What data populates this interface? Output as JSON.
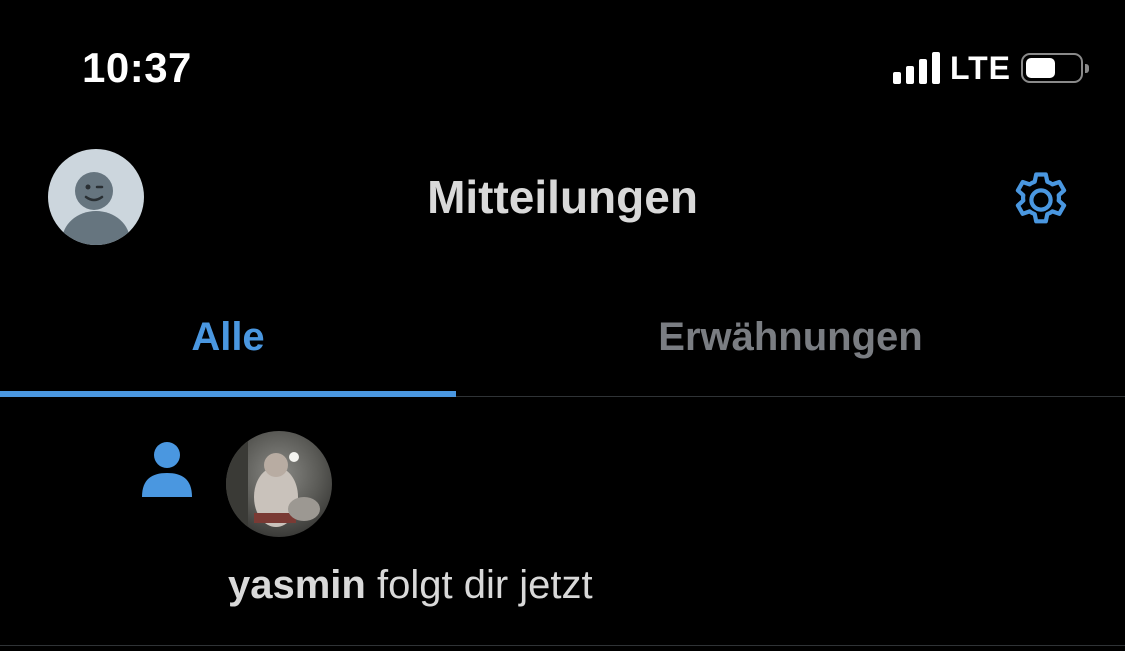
{
  "status_bar": {
    "time": "10:37",
    "carrier": "LTE",
    "signal_bars": 4,
    "battery_level": 0.55
  },
  "header": {
    "title": "Mitteilungen",
    "avatar_icon": "default-avatar-icon",
    "settings_icon": "gear-icon"
  },
  "tabs": [
    {
      "label": "Alle",
      "active": true
    },
    {
      "label": "Erwähnungen",
      "active": false
    }
  ],
  "notifications": [
    {
      "type_icon": "person-follow-icon",
      "user": "yasmin",
      "action": " folgt dir jetzt"
    }
  ],
  "colors": {
    "accent": "#4a97e0",
    "background": "#000000",
    "text": "#d9d9d9",
    "muted": "#7a7d82",
    "divider": "#2f3336"
  }
}
